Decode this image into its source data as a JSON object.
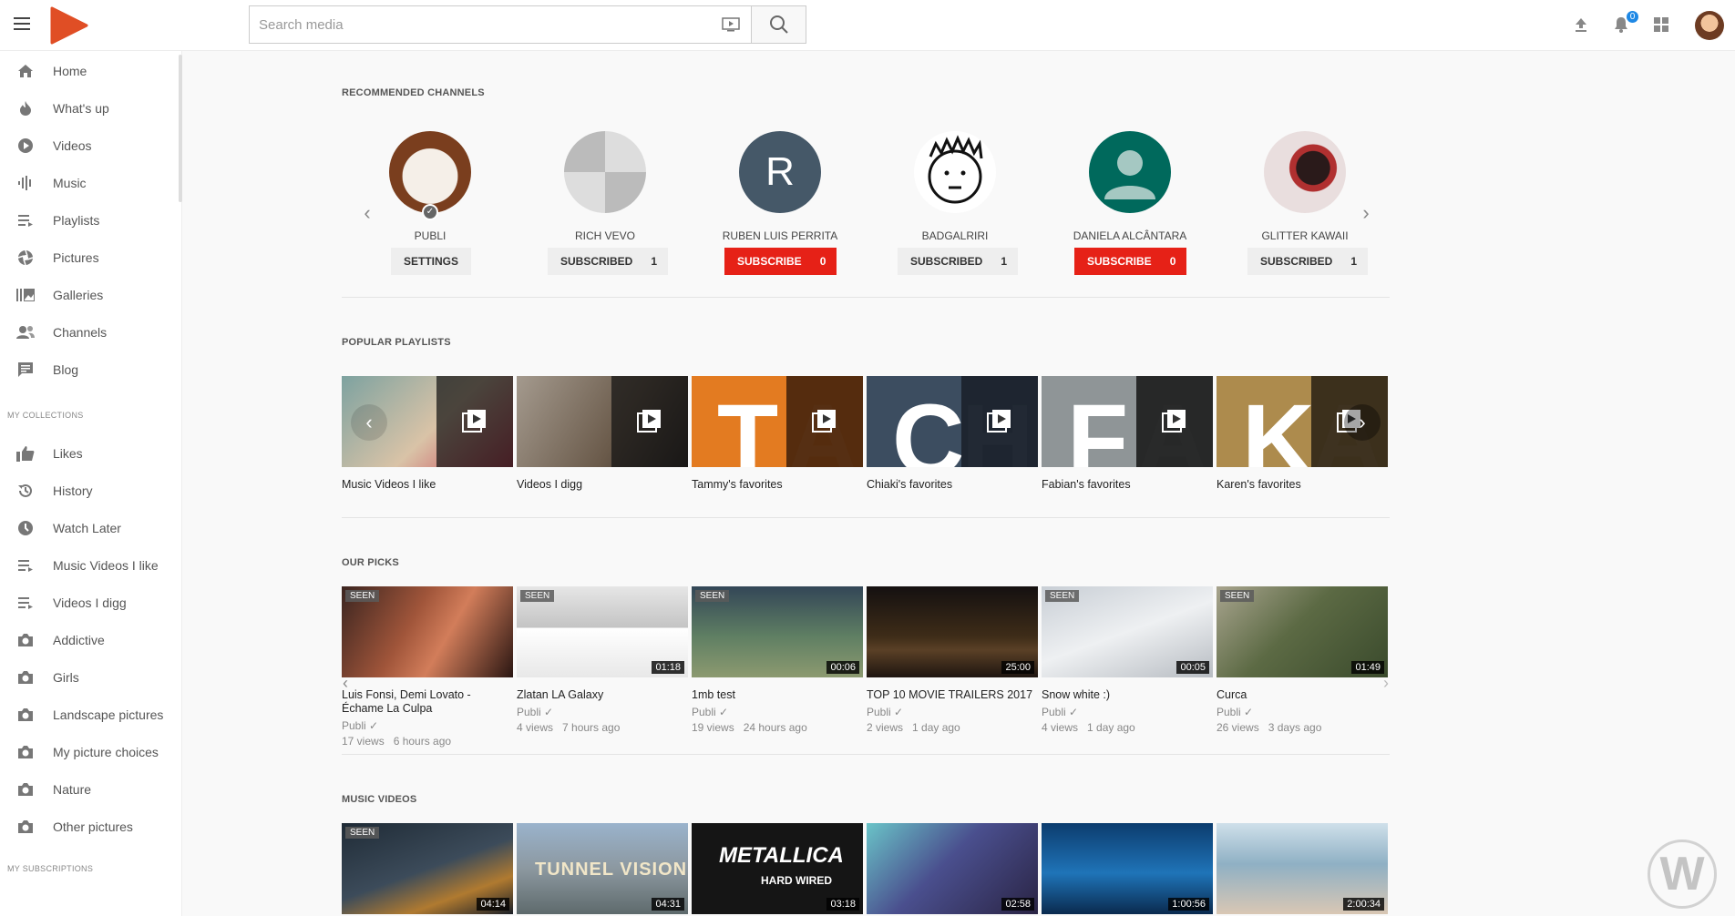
{
  "header": {
    "search_placeholder": "Search media",
    "notification_count": "0"
  },
  "sidebar": {
    "items": [
      {
        "label": "Home",
        "icon": "home-icon"
      },
      {
        "label": "What's up",
        "icon": "flame-icon"
      },
      {
        "label": "Videos",
        "icon": "play-circle-icon"
      },
      {
        "label": "Music",
        "icon": "audio-wave-icon"
      },
      {
        "label": "Playlists",
        "icon": "playlist-icon"
      },
      {
        "label": "Pictures",
        "icon": "aperture-icon"
      },
      {
        "label": "Galleries",
        "icon": "gallery-icon"
      },
      {
        "label": "Channels",
        "icon": "users-icon"
      },
      {
        "label": "Blog",
        "icon": "blog-icon"
      }
    ],
    "collections_title": "MY COLLECTIONS",
    "collections": [
      {
        "label": "Likes",
        "icon": "thumbs-up-icon"
      },
      {
        "label": "History",
        "icon": "history-icon"
      },
      {
        "label": "Watch Later",
        "icon": "clock-icon"
      },
      {
        "label": "Music Videos I like",
        "icon": "playlist-icon"
      },
      {
        "label": "Videos I digg",
        "icon": "playlist-icon"
      },
      {
        "label": "Addictive",
        "icon": "camera-icon"
      },
      {
        "label": "Girls",
        "icon": "camera-icon"
      },
      {
        "label": "Landscape pictures",
        "icon": "camera-icon"
      },
      {
        "label": "My picture choices",
        "icon": "camera-icon"
      },
      {
        "label": "Nature",
        "icon": "camera-icon"
      },
      {
        "label": "Other pictures",
        "icon": "camera-icon"
      }
    ],
    "subscriptions_title": "MY SUBSCRIPTIONS"
  },
  "recommended": {
    "title": "RECOMMENDED CHANNELS",
    "channels": [
      {
        "name": "PUBLI",
        "button": "SETTINGS",
        "count": "",
        "style": "plain"
      },
      {
        "name": "RICH VEVO",
        "button": "SUBSCRIBED",
        "count": "1",
        "style": "plain"
      },
      {
        "name": "RUBEN LUIS PERRITA",
        "button": "SUBSCRIBE",
        "count": "0",
        "style": "red",
        "initial": "R"
      },
      {
        "name": "BADGALRIRI",
        "button": "SUBSCRIBED",
        "count": "1",
        "style": "plain"
      },
      {
        "name": "DANIELA ALCÂNTARA",
        "button": "SUBSCRIBE",
        "count": "0",
        "style": "red"
      },
      {
        "name": "GLITTER KAWAII",
        "button": "SUBSCRIBED",
        "count": "1",
        "style": "plain"
      }
    ]
  },
  "playlists": {
    "title": "POPULAR PLAYLISTS",
    "items": [
      {
        "title": "Music Videos I like",
        "letter": "",
        "bg": "#c9b8a0"
      },
      {
        "title": "Videos I digg",
        "letter": "",
        "bg": "#8d8478"
      },
      {
        "title": "Tammy's favorites",
        "letter": "T",
        "ghost": "A",
        "bg": "#e37b21"
      },
      {
        "title": "Chiaki's favorites",
        "letter": "C",
        "ghost": "H",
        "bg": "#3c4d60"
      },
      {
        "title": "Fabian's favorites",
        "letter": "F",
        "ghost": "A",
        "bg": "#8f9597"
      },
      {
        "title": "Karen's favorites",
        "letter": "K",
        "ghost": "A",
        "bg": "#ad8b4d"
      }
    ]
  },
  "picks": {
    "title": "OUR PICKS",
    "items": [
      {
        "title": "Luis Fonsi, Demi Lovato - Échame La Culpa",
        "channel": "Publi",
        "views": "17 views",
        "ago": "6 hours ago",
        "seen": "SEEN",
        "duration": "",
        "bg": "#6b3a2c"
      },
      {
        "title": "Zlatan LA Galaxy",
        "channel": "Publi",
        "views": "4 views",
        "ago": "7 hours ago",
        "seen": "SEEN",
        "duration": "01:18",
        "bg": "#d7d7d7"
      },
      {
        "title": "1mb test",
        "channel": "Publi",
        "views": "19 views",
        "ago": "24 hours ago",
        "seen": "SEEN",
        "duration": "00:06",
        "bg": "#4e7a52"
      },
      {
        "title": "TOP 10 MOVIE TRAILERS 2017",
        "channel": "Publi",
        "views": "2 views",
        "ago": "1 day ago",
        "seen": "",
        "duration": "25:00",
        "bg": "#3a2a18"
      },
      {
        "title": "Snow white :)",
        "channel": "Publi",
        "views": "4 views",
        "ago": "1 day ago",
        "seen": "SEEN",
        "duration": "00:05",
        "bg": "#d9dde2"
      },
      {
        "title": "Curca",
        "channel": "Publi",
        "views": "26 views",
        "ago": "3 days ago",
        "seen": "SEEN",
        "duration": "01:49",
        "bg": "#6f7b5a"
      }
    ]
  },
  "music_videos": {
    "title": "MUSIC VIDEOS",
    "items": [
      {
        "seen": "SEEN",
        "duration": "04:14",
        "bg": "#2f3a44"
      },
      {
        "seen": "",
        "duration": "04:31",
        "bg": "#8ca0b6",
        "label": "TUNNEL VISION"
      },
      {
        "seen": "",
        "duration": "03:18",
        "bg": "#151515",
        "label": "METALLICA"
      },
      {
        "seen": "",
        "duration": "02:58",
        "bg": "#4a5d8a"
      },
      {
        "seen": "",
        "duration": "1:00:56",
        "bg": "#1a5f98"
      },
      {
        "seen": "",
        "duration": "2:00:34",
        "bg": "#b9cbd6"
      }
    ]
  },
  "playlist_sub_labels": {
    "hard_wired": "HARD WIRED"
  },
  "colors": {
    "accent_red": "#e62117",
    "logo": "#e04e25",
    "badge_blue": "#1e88e5"
  }
}
